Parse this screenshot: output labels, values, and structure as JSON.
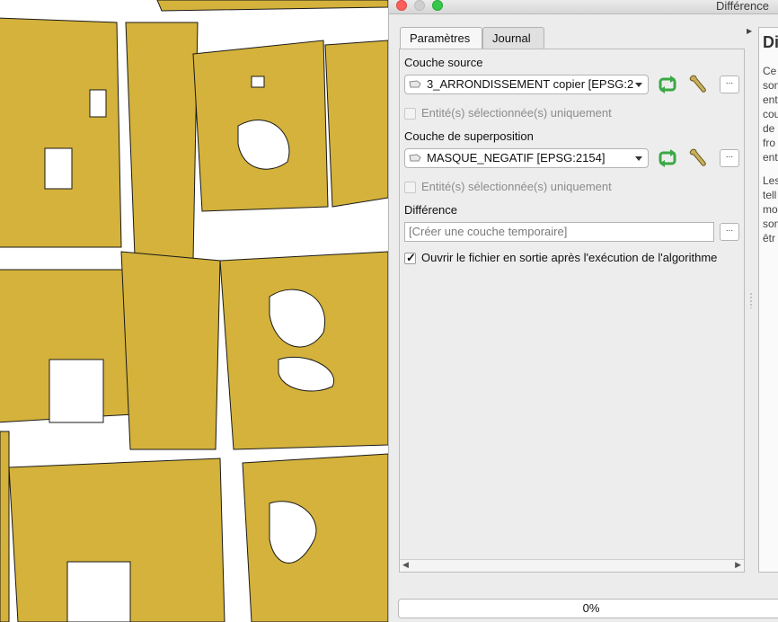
{
  "window": {
    "title": "Différence"
  },
  "tabs": [
    {
      "label": "Paramètres",
      "active": true
    },
    {
      "label": "Journal",
      "active": false
    }
  ],
  "form": {
    "source_label": "Couche source",
    "source_value": "3_ARRONDISSEMENT copier [EPSG:2",
    "source_selected_only": "Entité(s) sélectionnée(s) uniquement",
    "overlay_label": "Couche de superposition",
    "overlay_value": "MASQUE_NEGATIF [EPSG:2154]",
    "overlay_selected_only": "Entité(s) sélectionnée(s) uniquement",
    "output_label": "Différence",
    "output_placeholder": "[Créer une couche temporaire]",
    "open_output": "Ouvrir le fichier en sortie après l'exécution de l'algorithme",
    "open_output_checked": true,
    "dots_label": "..."
  },
  "help": {
    "title": "Di",
    "lines": [
      "Ce",
      "son",
      "ent",
      "cou",
      "de",
      "fro",
      "ent",
      "",
      "Les",
      "tell",
      "mo",
      "son",
      "êtr"
    ]
  },
  "progress": {
    "text": "0%",
    "value": 0
  },
  "colors": {
    "map_fill": "#d4b23b",
    "map_background": "#ffffff",
    "reload_icon": "#3aa845"
  },
  "icons": {
    "layer": "polygon-layer-icon",
    "reload": "iterate-icon",
    "settings": "wrench-icon"
  }
}
